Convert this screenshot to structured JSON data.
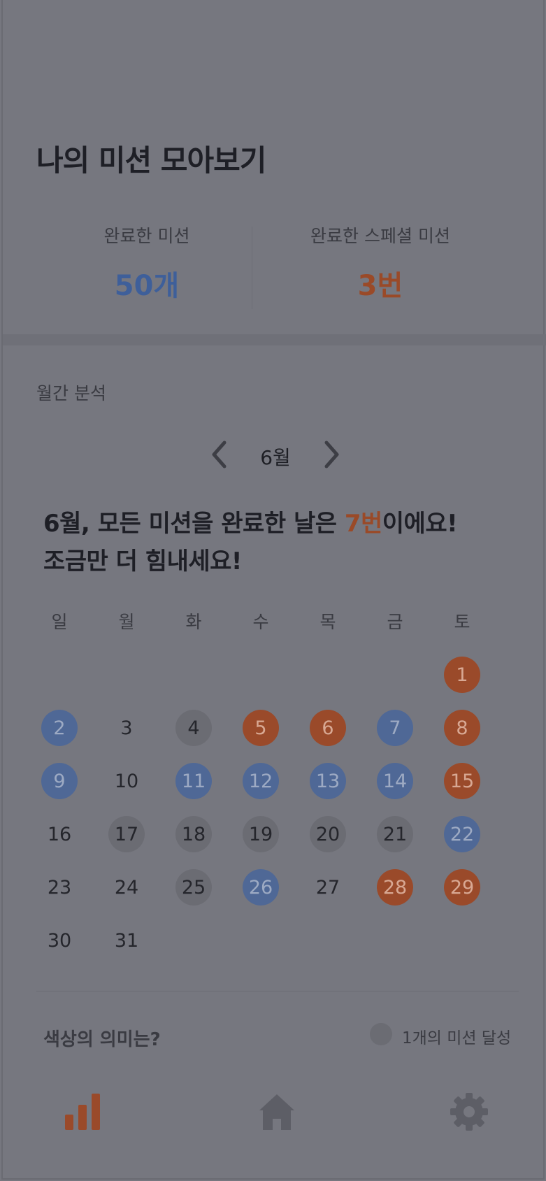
{
  "header": {
    "title": "나의 미션 모아보기"
  },
  "stats": {
    "completed_label": "완료한 미션",
    "completed_value": "50개",
    "special_label": "완료한 스페셜 미션",
    "special_value": "3번"
  },
  "monthly": {
    "section_label": "월간 분석",
    "month_label": "6월",
    "headline_prefix": "6월, 모든 미션을 완료한 날은 ",
    "headline_count": "7번",
    "headline_suffix": "이에요!",
    "headline_line2": "조금만 더 힘내세요!"
  },
  "calendar": {
    "weekdays": [
      "일",
      "월",
      "화",
      "수",
      "목",
      "금",
      "토"
    ],
    "first_weekday_index": 6,
    "days": [
      {
        "day": "1",
        "status": "orange"
      },
      {
        "day": "2",
        "status": "blue"
      },
      {
        "day": "3",
        "status": "none"
      },
      {
        "day": "4",
        "status": "gray"
      },
      {
        "day": "5",
        "status": "orange"
      },
      {
        "day": "6",
        "status": "orange"
      },
      {
        "day": "7",
        "status": "blue"
      },
      {
        "day": "8",
        "status": "orange"
      },
      {
        "day": "9",
        "status": "blue"
      },
      {
        "day": "10",
        "status": "none"
      },
      {
        "day": "11",
        "status": "blue"
      },
      {
        "day": "12",
        "status": "blue"
      },
      {
        "day": "13",
        "status": "blue"
      },
      {
        "day": "14",
        "status": "blue"
      },
      {
        "day": "15",
        "status": "orange"
      },
      {
        "day": "16",
        "status": "none"
      },
      {
        "day": "17",
        "status": "gray"
      },
      {
        "day": "18",
        "status": "gray"
      },
      {
        "day": "19",
        "status": "gray"
      },
      {
        "day": "20",
        "status": "gray"
      },
      {
        "day": "21",
        "status": "gray"
      },
      {
        "day": "22",
        "status": "blue"
      },
      {
        "day": "23",
        "status": "none"
      },
      {
        "day": "24",
        "status": "none"
      },
      {
        "day": "25",
        "status": "gray"
      },
      {
        "day": "26",
        "status": "blue"
      },
      {
        "day": "27",
        "status": "none"
      },
      {
        "day": "28",
        "status": "orange"
      },
      {
        "day": "29",
        "status": "orange"
      },
      {
        "day": "30",
        "status": "none"
      },
      {
        "day": "31",
        "status": "none"
      }
    ]
  },
  "legend": {
    "question": "색상의 의미는?",
    "item_label": "1개의 미션 달성"
  },
  "tabbar": {
    "items": [
      {
        "icon": "bar-chart-icon",
        "active": true
      },
      {
        "icon": "home-icon",
        "active": false
      },
      {
        "icon": "gear-icon",
        "active": false
      }
    ]
  },
  "colors": {
    "overlay_bg": "#76777f",
    "blue": "#4f6896",
    "orange": "#9a4a2a",
    "gray": "#6b6c73",
    "accent_orange_text": "#9a4a28",
    "accent_blue_text": "#3e5f9a"
  }
}
